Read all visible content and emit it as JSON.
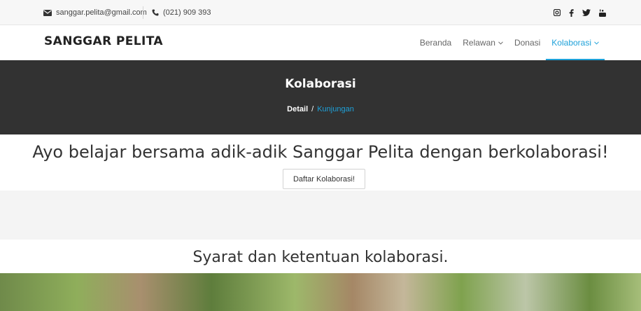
{
  "topbar": {
    "email": "sanggar.pelita@gmail.com",
    "phone": "(021) 909 393",
    "socials": [
      "instagram-icon",
      "facebook-icon",
      "twitter-icon",
      "youtube-icon"
    ]
  },
  "navbar": {
    "brand": "SANGGAR PELITA",
    "items": [
      {
        "label": "Beranda",
        "dropdown": false,
        "active": false
      },
      {
        "label": "Relawan",
        "dropdown": true,
        "active": false
      },
      {
        "label": "Donasi",
        "dropdown": false,
        "active": false
      },
      {
        "label": "Kolaborasi",
        "dropdown": true,
        "active": true
      }
    ]
  },
  "hero": {
    "title": "Kolaborasi",
    "breadcrumb": {
      "parent": "Detail",
      "separator": "/",
      "current": "Kunjungan"
    }
  },
  "main": {
    "headline": "Ayo belajar bersama adik-adik Sanggar Pelita dengan berkolaborasi!",
    "button": "Daftar Kolaborasi!",
    "subhead": "Syarat dan ketentuan kolaborasi."
  },
  "colors": {
    "accent": "#1ea1d9",
    "hero_bg": "#323232",
    "topbar_bg": "#f7f7f7"
  }
}
